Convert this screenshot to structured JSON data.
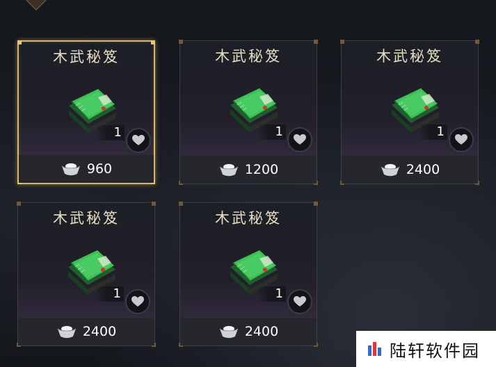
{
  "items": [
    {
      "name": "木武秘笈",
      "count": "1",
      "price": "960",
      "selected": true
    },
    {
      "name": "木武秘笈",
      "count": "1",
      "price": "1200",
      "selected": false
    },
    {
      "name": "木武秘笈",
      "count": "1",
      "price": "2400",
      "selected": false
    },
    {
      "name": "木武秘笈",
      "count": "1",
      "price": "2400",
      "selected": false
    },
    {
      "name": "木武秘笈",
      "count": "1",
      "price": "2400",
      "selected": false
    }
  ],
  "icons": {
    "item": "green-book-icon",
    "favorite": "heart-icon",
    "currency": "silver-ingot-icon"
  },
  "colors": {
    "selected_border": "#d9b768",
    "title_text": "#e6dcc2",
    "book_green": "#3fbf55"
  },
  "watermark": {
    "text": "陆轩软件园"
  }
}
